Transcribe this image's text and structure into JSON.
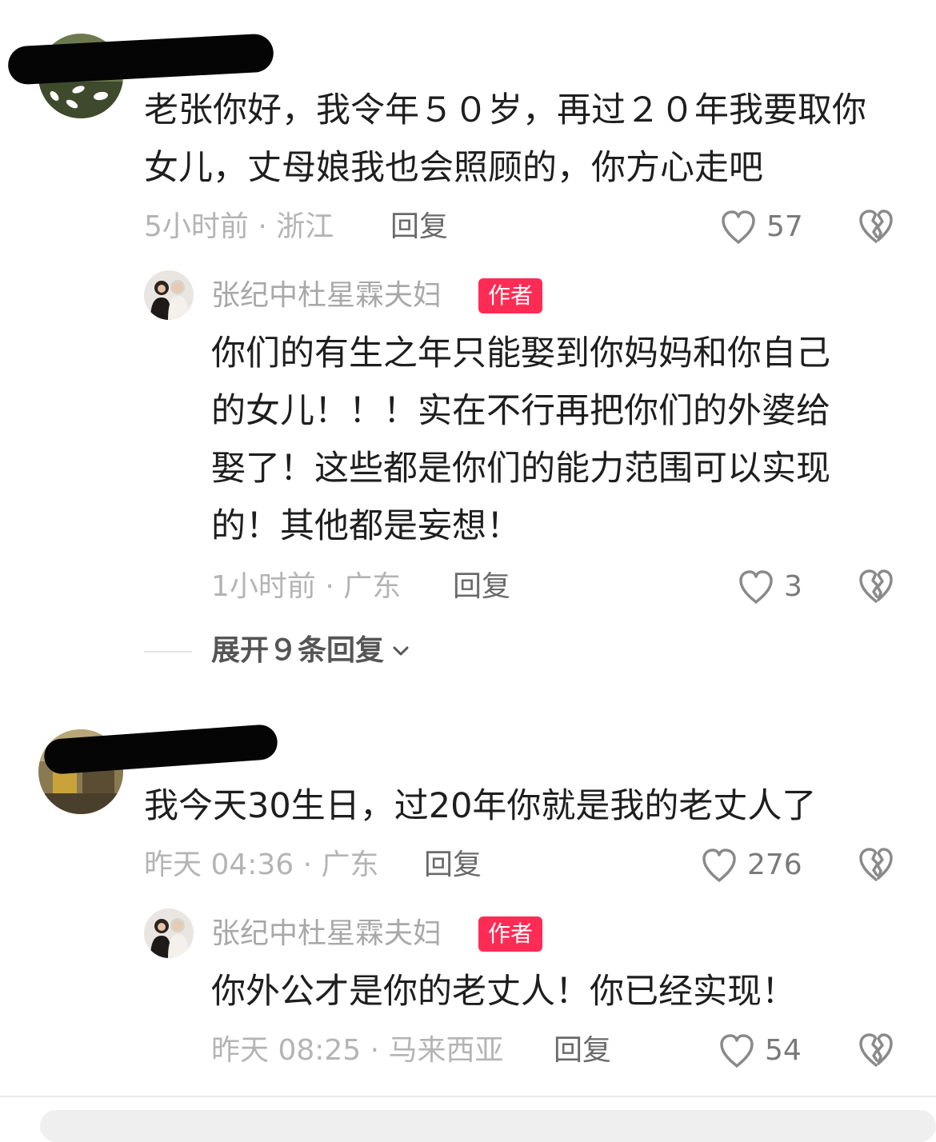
{
  "comments": [
    {
      "text_lines": [
        "老张你好，我令年５０岁，再过２０年我要取你",
        "女儿，丈母娘我也会照顾的，你方心走吧"
      ],
      "meta": "5小时前 · 浙江",
      "reply_label": "回复",
      "likes": "57",
      "reply": {
        "author": "张纪中杜星霖夫妇",
        "tag": "作者",
        "text_lines": [
          "你们的有生之年只能娶到你妈妈和你自己",
          "的女儿！！！实在不行再把你们的外婆给",
          "娶了！这些都是你们的能力范围可以实现",
          "的！其他都是妄想！"
        ],
        "meta": "1小时前 · 广东",
        "reply_label": "回复",
        "likes": "3"
      },
      "expand_label": "展开９条回复"
    },
    {
      "text_lines": [
        "我今天30生日，过20年你就是我的老丈人了"
      ],
      "meta": "昨天 04:36 · 广东",
      "reply_label": "回复",
      "likes": "276",
      "reply": {
        "author": "张纪中杜星霖夫妇",
        "tag": "作者",
        "text_lines": [
          "你外公才是你的老丈人！你已经实现！"
        ],
        "meta": "昨天 08:25 · 马来西亚",
        "reply_label": "回复",
        "likes": "54"
      }
    }
  ],
  "icons": {
    "like": "heart-outline-icon",
    "dislike": "broken-heart-icon",
    "expand": "chevron-down-icon"
  },
  "colors": {
    "author_tag": "#fe2c55",
    "meta_text": "#b4b4b4",
    "body_text": "#1e1e1e"
  }
}
